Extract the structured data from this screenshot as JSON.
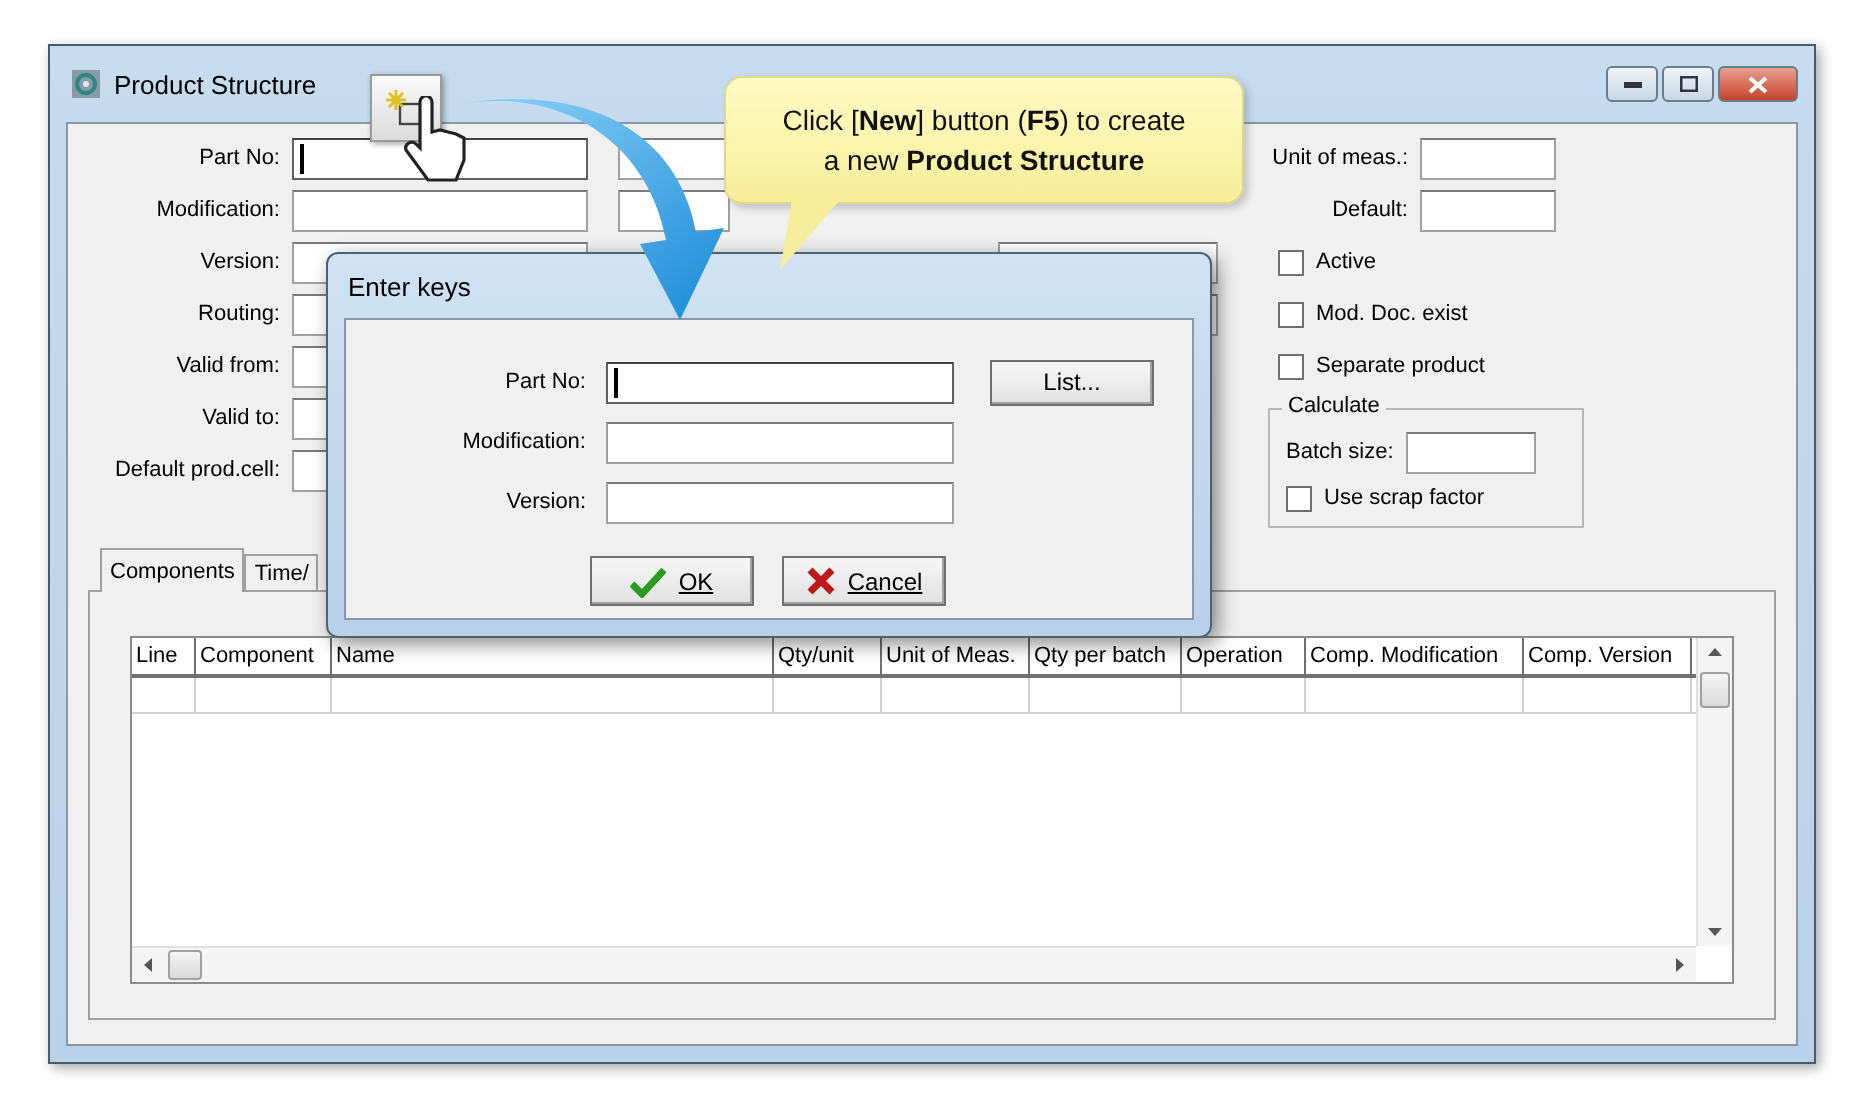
{
  "window": {
    "title": "Product Structure"
  },
  "form": {
    "left_fields": [
      {
        "label": "Part No:",
        "focused": true
      },
      {
        "label": "Modification:",
        "focused": false
      },
      {
        "label": "Version:",
        "focused": false
      },
      {
        "label": "Routing:",
        "focused": false
      },
      {
        "label": "Valid from:",
        "focused": false
      },
      {
        "label": "Valid to:",
        "focused": false
      },
      {
        "label": "Default prod.cell:",
        "focused": false
      }
    ],
    "right_fields": [
      {
        "label": "Unit of meas.:"
      },
      {
        "label": "Default:"
      }
    ],
    "checkboxes": [
      {
        "label": "Active",
        "checked": false
      },
      {
        "label": "Mod. Doc. exist",
        "checked": false
      },
      {
        "label": "Separate product",
        "checked": false
      }
    ],
    "calculate": {
      "title": "Calculate",
      "batch_size_label": "Batch size:",
      "scrap": {
        "label": "Use scrap factor",
        "checked": false
      }
    }
  },
  "tabs": [
    {
      "label": "Components",
      "selected": true
    },
    {
      "label": "Time/",
      "selected": false
    }
  ],
  "table": {
    "columns": [
      "Line",
      "Component",
      "Name",
      "Qty/unit",
      "Unit of Meas.",
      "Qty per batch",
      "Operation",
      "Comp. Modification",
      "Comp. Version"
    ]
  },
  "dialog": {
    "title": "Enter keys",
    "fields": [
      {
        "label": "Part No:",
        "focused": true
      },
      {
        "label": "Modification:",
        "focused": false
      },
      {
        "label": "Version:",
        "focused": false
      }
    ],
    "list_button": "List...",
    "ok": "OK",
    "cancel": "Cancel"
  },
  "callout": {
    "lines": [
      "Click [**New**] button (**F5**) to create",
      "a new **Product Structure**"
    ]
  }
}
